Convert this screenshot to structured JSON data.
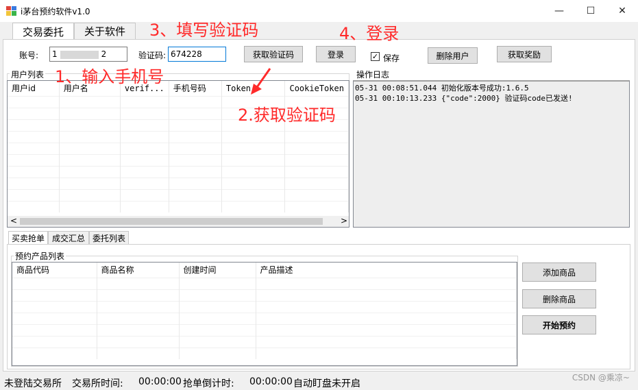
{
  "window": {
    "title": "i茅台预约软件v1.0",
    "minimize": "—",
    "maximize": "☐",
    "close": "✕"
  },
  "main_tabs": [
    {
      "label": "交易委托"
    },
    {
      "label": "关于软件"
    }
  ],
  "login": {
    "account_label": "账号:",
    "account_value": "1",
    "account_tail": "2",
    "code_label": "验证码:",
    "code_value": "674228",
    "get_code_button": "获取验证码",
    "login_button": "登录",
    "save_label": "保存",
    "save_checked": true,
    "delete_user_button": "删除用户",
    "get_reward_button": "获取奖励"
  },
  "users": {
    "group_title": "用户列表",
    "columns": [
      "用户id",
      "用户名",
      "verif...",
      "手机号码",
      "Token",
      "CookieToken"
    ],
    "rows": []
  },
  "log": {
    "group_title": "操作日志",
    "lines": [
      "05-31 00:08:51.044 初始化版本号成功:1.6.5",
      "05-31 00:10:13.233 {\"code\":2000} 验证码code已发送!"
    ]
  },
  "scroll": {
    "left_arrow": "<",
    "right_arrow": ">"
  },
  "sub_tabs": [
    {
      "label": "买卖抢单"
    },
    {
      "label": "成交汇总"
    },
    {
      "label": "委托列表"
    }
  ],
  "products": {
    "group_title": "预约产品列表",
    "columns": [
      "商品代码",
      "商品名称",
      "创建时间",
      "产品描述"
    ],
    "add_button": "添加商品",
    "delete_button": "删除商品",
    "start_button": "开始预约"
  },
  "annotations": {
    "step1": "1、输入手机号",
    "step2": "2.获取验证码",
    "step3": "3、填写验证码",
    "step4": "4、登录"
  },
  "status": {
    "login_state": "未登陆交易所",
    "exchange_time_label": "交易所时间:",
    "exchange_time": "00:00:00",
    "countdown_label": "抢单倒计时:",
    "countdown": "00:00:00",
    "auto_monitor": "自动盯盘未开启"
  },
  "watermark": "CSDN @乘凉~",
  "colors": {
    "annotation": "#ff2a2a",
    "focus_border": "#0078d7"
  }
}
